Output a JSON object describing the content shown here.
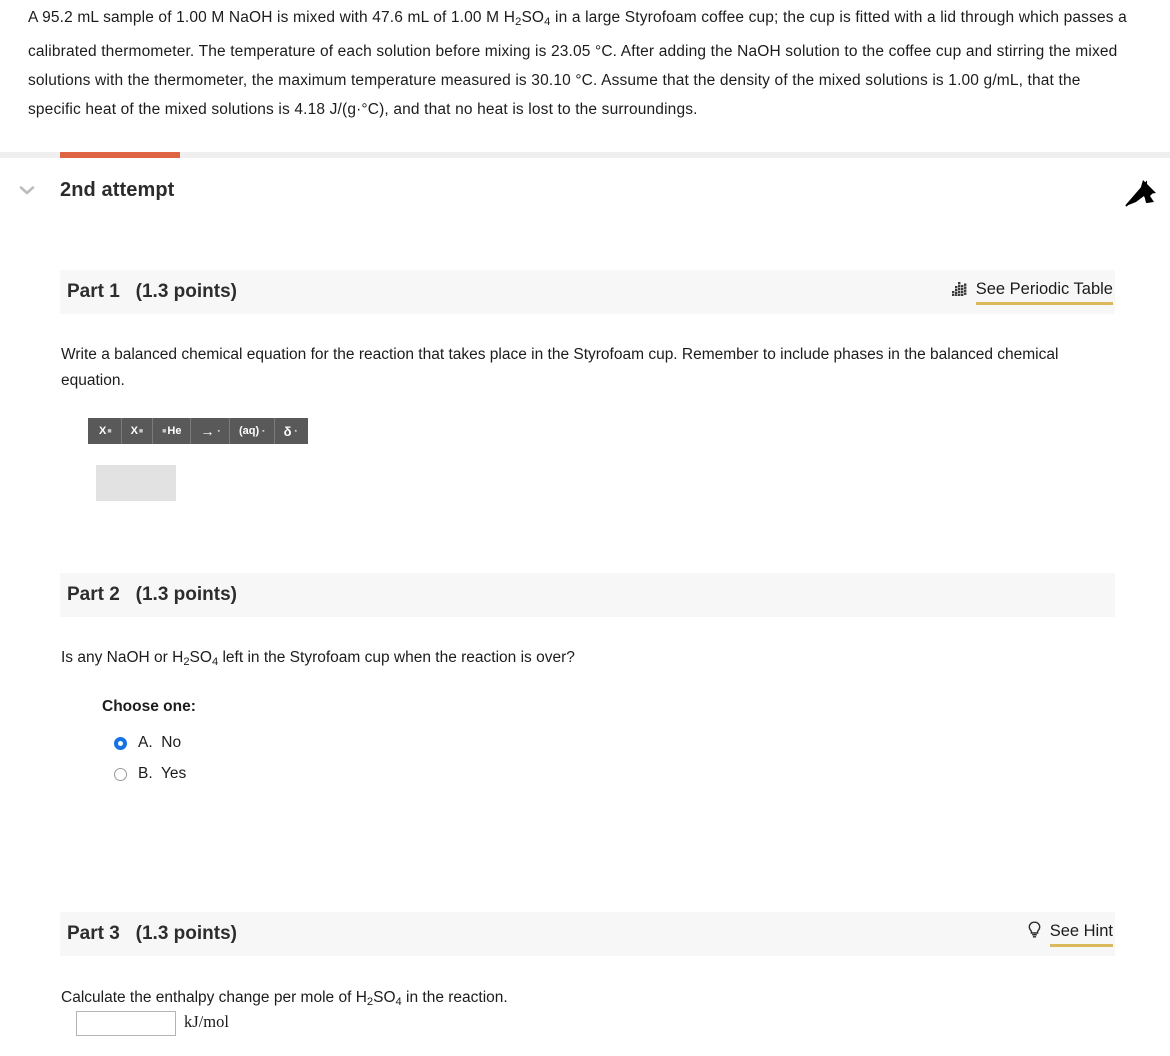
{
  "problem": {
    "text": "A 95.2 mL sample of 1.00 M NaOH is mixed with 47.6  mL of 1.00 M H₂SO₄ in a large Styrofoam coffee cup; the cup is fitted with a lid through which passes a calibrated thermometer. The temperature of each solution before mixing is 23.05 °C. After adding the NaOH solution to the coffee cup and stirring the mixed solutions with the thermometer, the maximum temperature measured is 30.10 °C. Assume that the density of the mixed solutions is 1.00 g/mL, that the specific heat of the mixed solutions is 4.18 J/(g·°C), and that no heat is lost to the surroundings."
  },
  "attempt": {
    "title": "2nd attempt",
    "collapse_icon": "chevron-down-icon",
    "pointer_icon": "cursor-arrow-icon",
    "progress_color": "#de6444"
  },
  "parts": [
    {
      "title": "Part 1   (1.3 points)",
      "action_label": "See Periodic Table",
      "action_icon": "periodic-table-icon",
      "question": "Write a balanced chemical equation for the reaction that takes place in the Styrofoam cup. Remember to include phases in the balanced chemical equation."
    },
    {
      "title": "Part 2   (1.3 points)",
      "question": "Is any NaOH or H₂SO₄ left in the Styrofoam cup when the reaction is over?",
      "choose_label": "Choose one:",
      "options": [
        {
          "text": "A.  No",
          "selected": true
        },
        {
          "text": "B.  Yes",
          "selected": false
        }
      ]
    },
    {
      "title": "Part 3   (1.3 points)",
      "action_label": "See Hint",
      "action_icon": "lightbulb-icon",
      "question": "Calculate the enthalpy change per mole of H₂SO₄ in the reaction.",
      "answer_value": "",
      "answer_placeholder": "",
      "unit": "kJ/mol"
    }
  ],
  "chem_toolbar": {
    "buttons": [
      {
        "label": "X",
        "mod": "superscript",
        "name": "superscript-button"
      },
      {
        "label": "X",
        "mod": "subscript",
        "name": "subscript-button"
      },
      {
        "label": "He",
        "mod": "isotope",
        "name": "isotope-button"
      },
      {
        "label": "→",
        "mod": "arrow",
        "name": "reaction-arrow-button"
      },
      {
        "label": "(aq)",
        "mod": "phase",
        "name": "phase-button"
      },
      {
        "label": "δ",
        "mod": "delta",
        "name": "delta-button"
      }
    ],
    "answer_value": ""
  },
  "colors": {
    "accent_orange": "#de6444",
    "underline_gold": "#d9b95c",
    "radio_blue": "#1673e6",
    "toolbar_gray": "#595959"
  }
}
